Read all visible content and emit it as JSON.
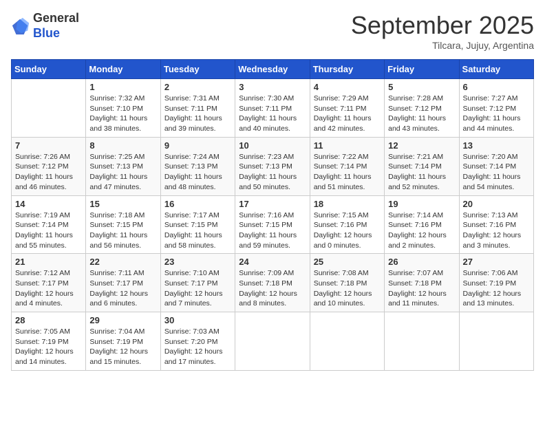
{
  "header": {
    "logo_general": "General",
    "logo_blue": "Blue",
    "month": "September 2025",
    "location": "Tilcara, Jujuy, Argentina"
  },
  "weekdays": [
    "Sunday",
    "Monday",
    "Tuesday",
    "Wednesday",
    "Thursday",
    "Friday",
    "Saturday"
  ],
  "weeks": [
    [
      {
        "day": "",
        "sunrise": "",
        "sunset": "",
        "daylight": ""
      },
      {
        "day": "1",
        "sunrise": "7:32 AM",
        "sunset": "7:10 PM",
        "daylight": "11 hours and 38 minutes."
      },
      {
        "day": "2",
        "sunrise": "7:31 AM",
        "sunset": "7:11 PM",
        "daylight": "11 hours and 39 minutes."
      },
      {
        "day": "3",
        "sunrise": "7:30 AM",
        "sunset": "7:11 PM",
        "daylight": "11 hours and 40 minutes."
      },
      {
        "day": "4",
        "sunrise": "7:29 AM",
        "sunset": "7:11 PM",
        "daylight": "11 hours and 42 minutes."
      },
      {
        "day": "5",
        "sunrise": "7:28 AM",
        "sunset": "7:12 PM",
        "daylight": "11 hours and 43 minutes."
      },
      {
        "day": "6",
        "sunrise": "7:27 AM",
        "sunset": "7:12 PM",
        "daylight": "11 hours and 44 minutes."
      }
    ],
    [
      {
        "day": "7",
        "sunrise": "7:26 AM",
        "sunset": "7:12 PM",
        "daylight": "11 hours and 46 minutes."
      },
      {
        "day": "8",
        "sunrise": "7:25 AM",
        "sunset": "7:13 PM",
        "daylight": "11 hours and 47 minutes."
      },
      {
        "day": "9",
        "sunrise": "7:24 AM",
        "sunset": "7:13 PM",
        "daylight": "11 hours and 48 minutes."
      },
      {
        "day": "10",
        "sunrise": "7:23 AM",
        "sunset": "7:13 PM",
        "daylight": "11 hours and 50 minutes."
      },
      {
        "day": "11",
        "sunrise": "7:22 AM",
        "sunset": "7:14 PM",
        "daylight": "11 hours and 51 minutes."
      },
      {
        "day": "12",
        "sunrise": "7:21 AM",
        "sunset": "7:14 PM",
        "daylight": "11 hours and 52 minutes."
      },
      {
        "day": "13",
        "sunrise": "7:20 AM",
        "sunset": "7:14 PM",
        "daylight": "11 hours and 54 minutes."
      }
    ],
    [
      {
        "day": "14",
        "sunrise": "7:19 AM",
        "sunset": "7:14 PM",
        "daylight": "11 hours and 55 minutes."
      },
      {
        "day": "15",
        "sunrise": "7:18 AM",
        "sunset": "7:15 PM",
        "daylight": "11 hours and 56 minutes."
      },
      {
        "day": "16",
        "sunrise": "7:17 AM",
        "sunset": "7:15 PM",
        "daylight": "11 hours and 58 minutes."
      },
      {
        "day": "17",
        "sunrise": "7:16 AM",
        "sunset": "7:15 PM",
        "daylight": "11 hours and 59 minutes."
      },
      {
        "day": "18",
        "sunrise": "7:15 AM",
        "sunset": "7:16 PM",
        "daylight": "12 hours and 0 minutes."
      },
      {
        "day": "19",
        "sunrise": "7:14 AM",
        "sunset": "7:16 PM",
        "daylight": "12 hours and 2 minutes."
      },
      {
        "day": "20",
        "sunrise": "7:13 AM",
        "sunset": "7:16 PM",
        "daylight": "12 hours and 3 minutes."
      }
    ],
    [
      {
        "day": "21",
        "sunrise": "7:12 AM",
        "sunset": "7:17 PM",
        "daylight": "12 hours and 4 minutes."
      },
      {
        "day": "22",
        "sunrise": "7:11 AM",
        "sunset": "7:17 PM",
        "daylight": "12 hours and 6 minutes."
      },
      {
        "day": "23",
        "sunrise": "7:10 AM",
        "sunset": "7:17 PM",
        "daylight": "12 hours and 7 minutes."
      },
      {
        "day": "24",
        "sunrise": "7:09 AM",
        "sunset": "7:18 PM",
        "daylight": "12 hours and 8 minutes."
      },
      {
        "day": "25",
        "sunrise": "7:08 AM",
        "sunset": "7:18 PM",
        "daylight": "12 hours and 10 minutes."
      },
      {
        "day": "26",
        "sunrise": "7:07 AM",
        "sunset": "7:18 PM",
        "daylight": "12 hours and 11 minutes."
      },
      {
        "day": "27",
        "sunrise": "7:06 AM",
        "sunset": "7:19 PM",
        "daylight": "12 hours and 13 minutes."
      }
    ],
    [
      {
        "day": "28",
        "sunrise": "7:05 AM",
        "sunset": "7:19 PM",
        "daylight": "12 hours and 14 minutes."
      },
      {
        "day": "29",
        "sunrise": "7:04 AM",
        "sunset": "7:19 PM",
        "daylight": "12 hours and 15 minutes."
      },
      {
        "day": "30",
        "sunrise": "7:03 AM",
        "sunset": "7:20 PM",
        "daylight": "12 hours and 17 minutes."
      },
      {
        "day": "",
        "sunrise": "",
        "sunset": "",
        "daylight": ""
      },
      {
        "day": "",
        "sunrise": "",
        "sunset": "",
        "daylight": ""
      },
      {
        "day": "",
        "sunrise": "",
        "sunset": "",
        "daylight": ""
      },
      {
        "day": "",
        "sunrise": "",
        "sunset": "",
        "daylight": ""
      }
    ]
  ],
  "labels": {
    "sunrise_prefix": "Sunrise: ",
    "sunset_prefix": "Sunset: ",
    "daylight_prefix": "Daylight: "
  }
}
